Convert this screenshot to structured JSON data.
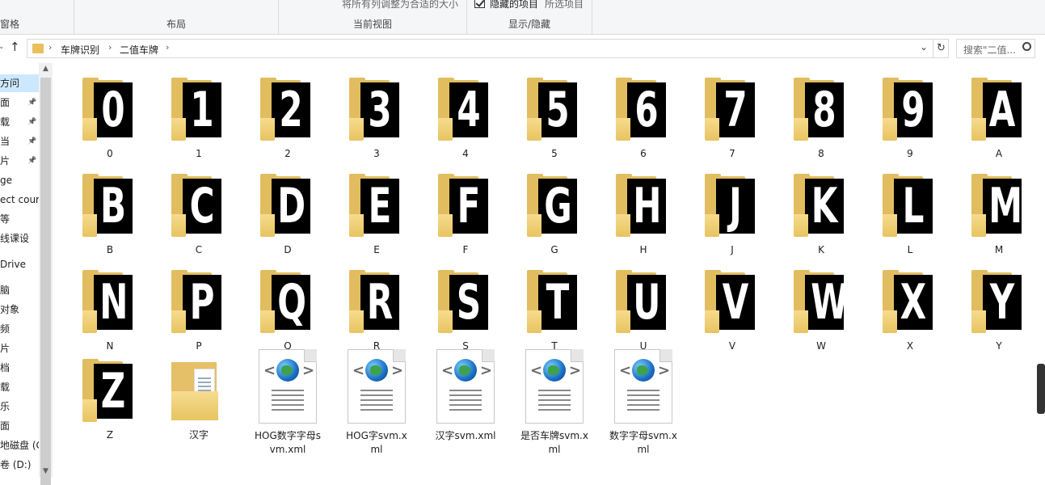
{
  "ribbon": {
    "pane_label": "窗格",
    "layout_label": "布局",
    "current_view_label": "当前视图",
    "resize_columns_label": "将所有列调整为合适的大小",
    "show_hide_label": "显示/隐藏",
    "hidden_items_label": "隐藏的项目",
    "selected_items_label": "所选项目"
  },
  "nav": {
    "breadcrumb": [
      "车牌识别",
      "二值车牌"
    ],
    "search_placeholder": "搜索\"二值...",
    "chevron": "›"
  },
  "sidebar": {
    "items": [
      {
        "label": "方问",
        "pinned": false
      },
      {
        "label": "面",
        "pinned": true
      },
      {
        "label": "载",
        "pinned": true
      },
      {
        "label": "当",
        "pinned": true
      },
      {
        "label": "片",
        "pinned": true
      },
      {
        "label": "ge",
        "pinned": false
      },
      {
        "label": "ect cour",
        "pinned": false
      },
      {
        "label": "等",
        "pinned": false
      },
      {
        "label": "线课设",
        "pinned": false
      },
      {
        "label": "Drive",
        "pinned": false
      },
      {
        "label": "脑",
        "pinned": false
      },
      {
        "label": "对象",
        "pinned": false
      },
      {
        "label": "频",
        "pinned": false
      },
      {
        "label": "片",
        "pinned": false
      },
      {
        "label": "档",
        "pinned": false
      },
      {
        "label": "载",
        "pinned": false
      },
      {
        "label": "乐",
        "pinned": false
      },
      {
        "label": "面",
        "pinned": false
      },
      {
        "label": "地磁盘 (C:",
        "pinned": false
      },
      {
        "label": "卷 (D:)",
        "pinned": false
      }
    ]
  },
  "items": [
    {
      "name": "0",
      "type": "folder",
      "glyph": "0"
    },
    {
      "name": "1",
      "type": "folder",
      "glyph": "1"
    },
    {
      "name": "2",
      "type": "folder",
      "glyph": "2"
    },
    {
      "name": "3",
      "type": "folder",
      "glyph": "3"
    },
    {
      "name": "4",
      "type": "folder",
      "glyph": "4"
    },
    {
      "name": "5",
      "type": "folder",
      "glyph": "5"
    },
    {
      "name": "6",
      "type": "folder",
      "glyph": "6"
    },
    {
      "name": "7",
      "type": "folder",
      "glyph": "7"
    },
    {
      "name": "8",
      "type": "folder",
      "glyph": "8"
    },
    {
      "name": "9",
      "type": "folder",
      "glyph": "9"
    },
    {
      "name": "A",
      "type": "folder",
      "glyph": "A"
    },
    {
      "name": "B",
      "type": "folder",
      "glyph": "B"
    },
    {
      "name": "C",
      "type": "folder",
      "glyph": "C"
    },
    {
      "name": "D",
      "type": "folder",
      "glyph": "D"
    },
    {
      "name": "E",
      "type": "folder",
      "glyph": "E"
    },
    {
      "name": "F",
      "type": "folder",
      "glyph": "F"
    },
    {
      "name": "G",
      "type": "folder",
      "glyph": "G"
    },
    {
      "name": "H",
      "type": "folder",
      "glyph": "H"
    },
    {
      "name": "J",
      "type": "folder",
      "glyph": "J"
    },
    {
      "name": "K",
      "type": "folder",
      "glyph": "K"
    },
    {
      "name": "L",
      "type": "folder",
      "glyph": "L"
    },
    {
      "name": "M",
      "type": "folder",
      "glyph": "M"
    },
    {
      "name": "N",
      "type": "folder",
      "glyph": "N"
    },
    {
      "name": "P",
      "type": "folder",
      "glyph": "P"
    },
    {
      "name": "Q",
      "type": "folder",
      "glyph": "Q"
    },
    {
      "name": "R",
      "type": "folder",
      "glyph": "R"
    },
    {
      "name": "S",
      "type": "folder",
      "glyph": "S"
    },
    {
      "name": "T",
      "type": "folder",
      "glyph": "T"
    },
    {
      "name": "U",
      "type": "folder",
      "glyph": "U"
    },
    {
      "name": "V",
      "type": "folder",
      "glyph": "V"
    },
    {
      "name": "W",
      "type": "folder",
      "glyph": "W"
    },
    {
      "name": "X",
      "type": "folder",
      "glyph": "X"
    },
    {
      "name": "Y",
      "type": "folder",
      "glyph": "Y"
    },
    {
      "name": "Z",
      "type": "folder",
      "glyph": "Z"
    },
    {
      "name": "汉字",
      "type": "folder-open"
    },
    {
      "name": "HOG数字字母svm.xml",
      "type": "xml"
    },
    {
      "name": "HOG字svm.xml",
      "type": "xml"
    },
    {
      "name": "汉字svm.xml",
      "type": "xml"
    },
    {
      "name": "是否车牌svm.xml",
      "type": "xml"
    },
    {
      "name": "数字字母svm.xml",
      "type": "xml"
    }
  ],
  "colors": {
    "folder": "#e2bd60",
    "selection": "#cce8ff",
    "accent": "#0078d7"
  }
}
